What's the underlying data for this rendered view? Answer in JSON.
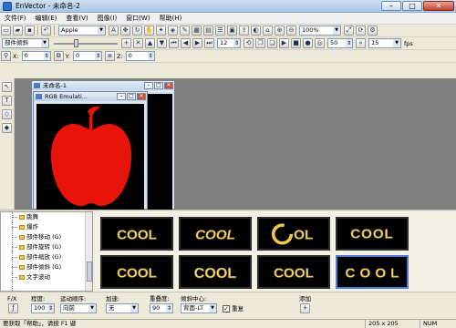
{
  "window": {
    "title": "EnVector - 未命名-2",
    "buttons": [
      "–",
      "□",
      "✕"
    ]
  },
  "menu": [
    "文件(F)",
    "编辑(E)",
    "查看(V)",
    "图像(I)",
    "窗口(W)",
    "帮助(H)"
  ],
  "toolbar1": {
    "font": "Apple",
    "zoom": "100%"
  },
  "toolbar2": {
    "mode": "部件倾斜",
    "frame": "12",
    "val1": "50",
    "fps_value": "15",
    "fps_label": "fps"
  },
  "toolbar3": {
    "x_label": "X:",
    "x_value": "0",
    "y_label": "Y:",
    "y_value": "0",
    "z_label": "Z:",
    "z_value": "0"
  },
  "docs": {
    "back_title": "未命名-1",
    "front_title": "RGB Emulati..."
  },
  "tree": {
    "items": [
      "跳舞",
      "爆炸",
      "部件移动 (G)",
      "部件旋转 (G)",
      "部件缩放 (G)",
      "部件倾斜 (G)",
      "文字波动"
    ]
  },
  "gallery": {
    "tiles": [
      {
        "text": "COOL",
        "style": "plain"
      },
      {
        "text": "COOL",
        "style": "slant"
      },
      {
        "text": "OL",
        "style": "ring"
      },
      {
        "text": "COOL",
        "style": "wave"
      },
      {
        "text": "COOL",
        "style": "plain"
      },
      {
        "text": "COOL",
        "style": "bold"
      },
      {
        "text": "COOL",
        "style": "plain"
      },
      {
        "text": "COOL",
        "style": "wide"
      }
    ],
    "selected_index": 7
  },
  "props": {
    "fx_label": "F/X",
    "degree_label": "程度:",
    "degree_value": "100",
    "dir_label": "运动顺序:",
    "dir_value": "向前",
    "accel_label": "加速:",
    "accel_value": "无",
    "overlap_label": "重叠度:",
    "overlap_value": "90",
    "center_label": "倾斜中心:",
    "center_value": "背面-LT",
    "repeat_label": "重复",
    "add_label": "添加"
  },
  "status": {
    "help": "要获取「帮助」，请按 F1 键",
    "size": "205 x 205",
    "num": "NUM"
  },
  "colors": {
    "apple": "#e8140a",
    "cool_text": "#f2d97a",
    "tile_bg": "#000000",
    "selected_border": "#4a7bd0"
  }
}
